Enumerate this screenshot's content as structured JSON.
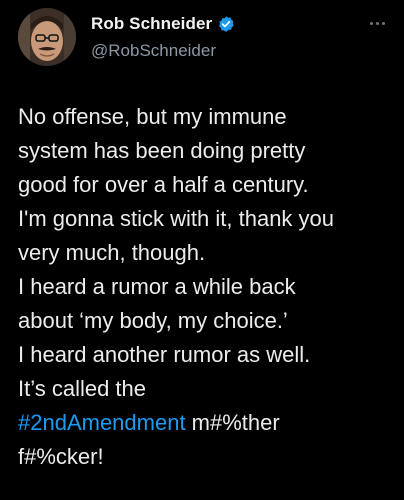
{
  "author": {
    "display_name": "Rob Schneider",
    "handle": "@RobSchneider",
    "verified": true,
    "avatar_icon": "profile-photo"
  },
  "menu": {
    "icon": "more-options-icon"
  },
  "tweet": {
    "lines": [
      "No offense, but my immune",
      "system has been doing pretty",
      "good for over a half a century.",
      "I'm gonna stick with it, thank you",
      "very much, though.",
      "I heard a rumor a while back",
      "about ‘my body, my choice.’",
      "I heard another rumor as well.",
      "It’s called the"
    ],
    "hashtag": "#2ndAmendment",
    "after_hashtag": " m#%ther",
    "last_line": "f#%cker!"
  },
  "colors": {
    "background": "#000000",
    "text": "#e7e9ea",
    "handle": "#8b98a5",
    "link": "#1d9bf0",
    "verified": "#1d9bf0"
  }
}
